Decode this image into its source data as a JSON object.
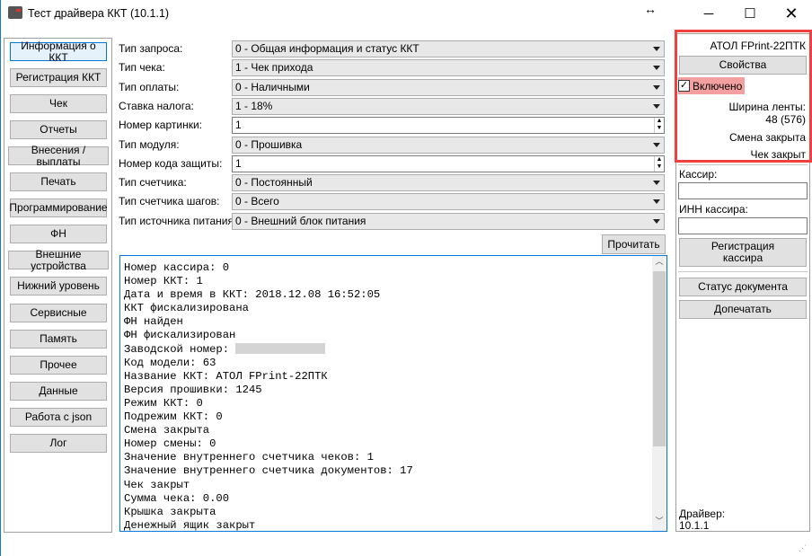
{
  "window": {
    "title": "Тест драйвера ККТ (10.1.1)",
    "icons": [
      "app-printer-icon",
      "resize-cursor-icon",
      "minimize-icon",
      "maximize-icon",
      "close-icon"
    ]
  },
  "sidebar": {
    "items": [
      "Информация о ККТ",
      "Регистрация ККТ",
      "Чек",
      "Отчеты",
      "Внесения / выплаты",
      "Печать",
      "Программирование",
      "ФН",
      "Внешние устройства",
      "Нижний уровень",
      "Сервисные",
      "Память",
      "Прочее",
      "Данные",
      "Работа с json",
      "Лог"
    ],
    "selected": 0
  },
  "form": {
    "rows": [
      {
        "label": "Тип запроса:",
        "value": "0 - Общая информация и статус ККТ",
        "kind": "select"
      },
      {
        "label": "Тип чека:",
        "value": "1 - Чек прихода",
        "kind": "select"
      },
      {
        "label": "Тип оплаты:",
        "value": "0 - Наличными",
        "kind": "select"
      },
      {
        "label": "Ставка налога:",
        "value": "1 - 18%",
        "kind": "select"
      },
      {
        "label": "Номер картинки:",
        "value": "1",
        "kind": "spin"
      },
      {
        "label": "Тип модуля:",
        "value": "0 - Прошивка",
        "kind": "select"
      },
      {
        "label": "Номер кода защиты:",
        "value": "1",
        "kind": "spin"
      },
      {
        "label": "Тип счетчика:",
        "value": "0 - Постоянный",
        "kind": "select"
      },
      {
        "label": "Тип счетчика шагов:",
        "value": "0 - Всего",
        "kind": "select"
      },
      {
        "label": "Тип источника питания:",
        "value": "0 - Внешний блок питания",
        "kind": "select"
      }
    ],
    "read_button": "Прочитать"
  },
  "log": {
    "lines": [
      "Номер кассира: 0",
      "Номер ККТ: 1",
      "Дата и время в ККТ: 2018.12.08 16:52:05",
      "ККТ фискализирована",
      "ФН найден",
      "ФН фискализирован",
      "Заводской номер: ",
      "Код модели: 63",
      "Название ККТ: АТОЛ FPrint-22ПТК",
      "Версия прошивки: 1245",
      "Режим ККТ: 0",
      "Подрежим ККТ: 0",
      "Смена закрыта",
      "Номер смены: 0",
      "Значение внутреннего счетчика чеков: 1",
      "Значение внутреннего счетчика документов: 17",
      "Чек закрыт",
      "Сумма чека: 0.00",
      "Крышка закрыта",
      "Денежный ящик закрыт"
    ]
  },
  "right": {
    "device": "АТОЛ FPrint-22ПТК",
    "properties": "Свойства",
    "enabled_label": "Включено",
    "enabled": true,
    "tape_label": "Ширина ленты:",
    "tape_value": "48 (576)",
    "shift": "Смена закрыта",
    "receipt": "Чек закрыт",
    "cashier_label": "Кассир:",
    "cashier_value": "",
    "inn_label": "ИНН кассира:",
    "inn_value": "",
    "register_cashier": "Регистрация кассира",
    "doc_status": "Статус документа",
    "reprint": "Допечатать",
    "driver_label": "Драйвер:",
    "driver_version": "10.1.1"
  },
  "colors": {
    "highlight": "#f04040",
    "accent": "#0078d7",
    "checkbox_bg": "#f4a0a0"
  }
}
